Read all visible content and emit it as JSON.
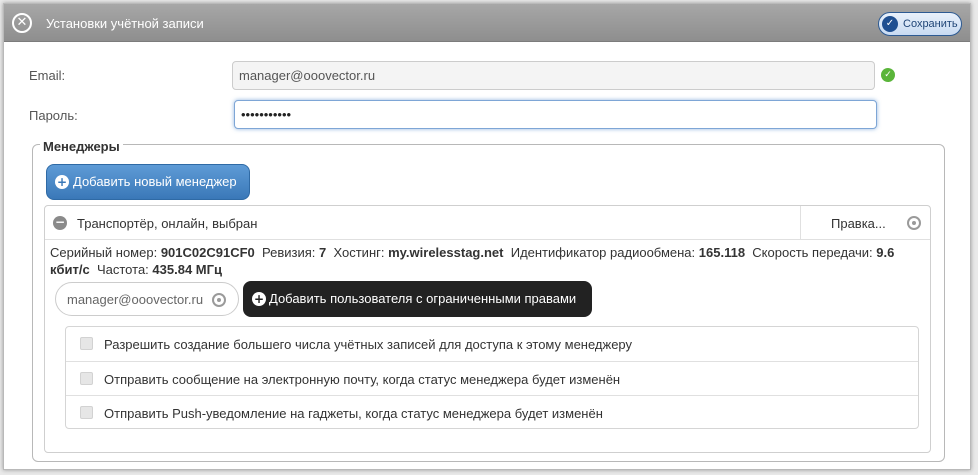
{
  "dialog": {
    "title": "Установки учётной записи",
    "save_label": "Сохранить"
  },
  "form": {
    "email_label": "Email:",
    "email_value": "manager@ooovector.ru",
    "password_label": "Пароль:",
    "password_value": "•••••••••••"
  },
  "managers": {
    "legend": "Менеджеры",
    "add_manager_label": "Добавить новый менеджер",
    "manager": {
      "name": "Транспортёр, онлайн, выбран",
      "edit_label": "Правка...",
      "serial_label": "Серийный номер:",
      "serial_value": "901C02C91CF0",
      "revision_label": "Ревизия:",
      "revision_value": "7",
      "hosting_label": "Хостинг:",
      "hosting_value": "my.wirelesstag.net",
      "radio_id_label": "Идентификатор радиообмена:",
      "radio_id_value": "165.118",
      "speed_label": "Скорость передачи:",
      "speed_value": "9.6 кбит/с",
      "frequency_label": "Частота:",
      "frequency_value": "435.84 МГц",
      "user_email": "manager@ooovector.ru",
      "add_user_label": "Добавить пользователя с ограниченными правами",
      "options": [
        "Разрешить создание большего числа учётных записей для доступа к этому менеджеру",
        "Отправить сообщение на электронную почту, когда статус менеджера будет изменён",
        "Отправить Push-уведомление на гаджеты, когда статус менеджера будет изменён"
      ]
    }
  },
  "colors": {
    "titlebar": "#9a9a9a",
    "primary_button": "#3a78b8",
    "dark_button": "#222222",
    "ok": "#5ab53a"
  }
}
